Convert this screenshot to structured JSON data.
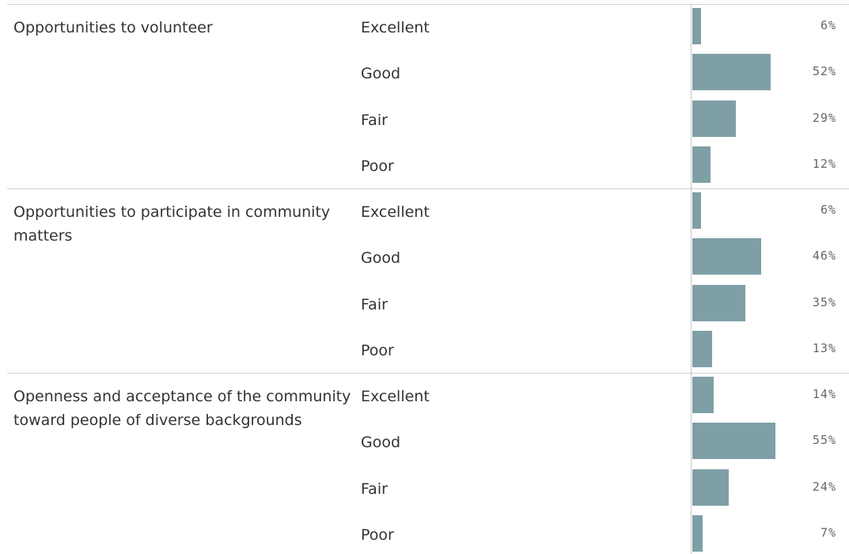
{
  "chart_data": {
    "type": "bar",
    "orientation": "horizontal",
    "value_format": "percent",
    "xlim": [
      0,
      100
    ],
    "bar_color": "#7f9fa6",
    "grid": false,
    "categories": [
      "Excellent",
      "Good",
      "Fair",
      "Poor"
    ],
    "groups": [
      {
        "topic": "Opportunities to volunteer",
        "values": [
          6,
          52,
          29,
          12
        ],
        "labels": [
          "6%",
          "52%",
          "29%",
          "12%"
        ]
      },
      {
        "topic": "Opportunities to participate in community matters",
        "values": [
          6,
          46,
          35,
          13
        ],
        "labels": [
          "6%",
          "46%",
          "35%",
          "13%"
        ]
      },
      {
        "topic": "Openness and acceptance of the community toward people of diverse backgrounds",
        "values": [
          14,
          55,
          24,
          7
        ],
        "labels": [
          "14%",
          "55%",
          "24%",
          "7%"
        ]
      }
    ]
  }
}
